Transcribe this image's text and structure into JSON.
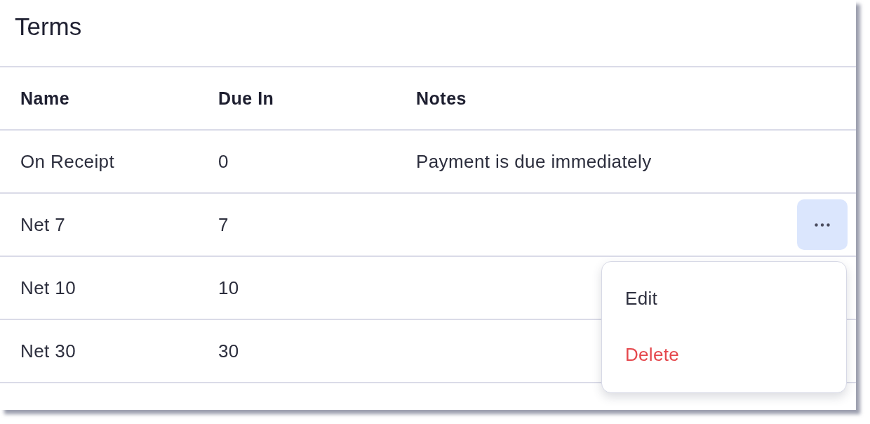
{
  "title": "Terms",
  "table": {
    "columns": [
      "Name",
      "Due In",
      "Notes"
    ],
    "rows": [
      {
        "name": "On Receipt",
        "due_in": "0",
        "notes": "Payment is due immediately",
        "menu_open": false
      },
      {
        "name": "Net 7",
        "due_in": "7",
        "menu_open": true
      },
      {
        "name": "Net 10",
        "due_in": "10",
        "menu_open": false
      },
      {
        "name": "Net 30",
        "due_in": "30",
        "menu_open": false
      }
    ]
  },
  "row_menu": {
    "items": [
      {
        "label": "Edit",
        "kind": "normal"
      },
      {
        "label": "Delete",
        "kind": "danger"
      }
    ]
  }
}
